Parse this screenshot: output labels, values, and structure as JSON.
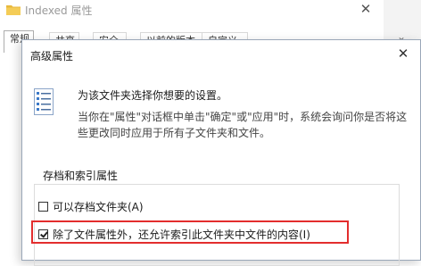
{
  "background_window": {
    "title": "Indexed 属性",
    "tabs": [
      "常规",
      "共享",
      "安全",
      "以前的版本",
      "自定义"
    ]
  },
  "dialog": {
    "title": "高级属性",
    "intro": "为该文件夹选择你想要的设置。",
    "desc_line1": "当你在\"属性\"对话框中单击\"确定\"或\"应用\"时，系统会询问你是否将这",
    "desc_line2": "些更改同时应用于所有子文件夹和文件。",
    "section_title": "存档和索引属性",
    "options": [
      {
        "label": "可以存档文件夹(A)",
        "checked": false
      },
      {
        "label": "除了文件属性外，还允许索引此文件夹中文件的内容(I)",
        "checked": true
      }
    ]
  },
  "colors": {
    "highlight": "#e32d2d",
    "folder": "#e8b93c",
    "dialog_border": "#9aa7b8"
  },
  "icons": [
    "folder-icon",
    "close-icon",
    "settings-list-icon",
    "chevron-down-icon",
    "checkmark-icon"
  ]
}
